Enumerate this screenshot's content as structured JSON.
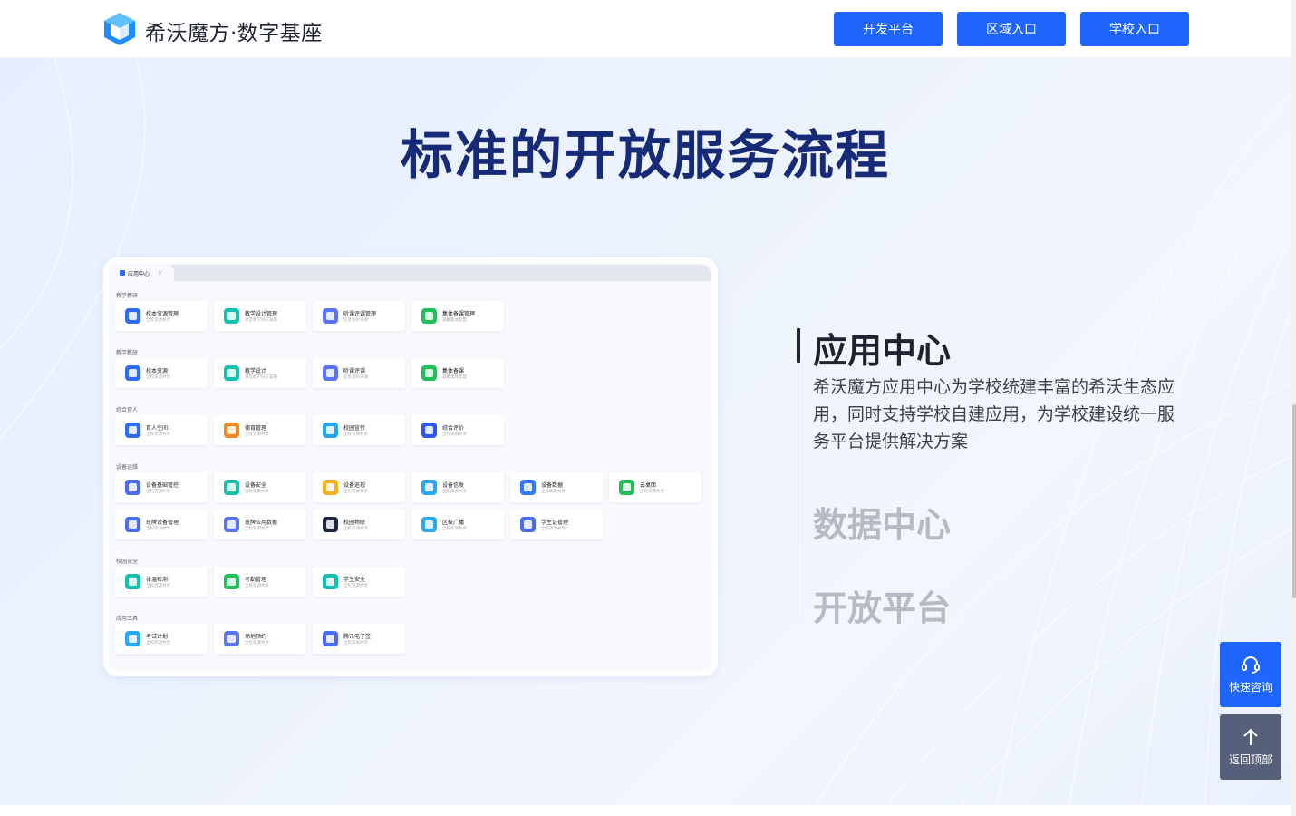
{
  "header": {
    "brand": "希沃魔方·数字基座",
    "buttons": [
      "开发平台",
      "区域入口",
      "学校入口"
    ]
  },
  "hero": {
    "title": "标准的开放服务流程"
  },
  "app_window": {
    "tab_label": "应用中心",
    "tab_close": "×",
    "sections": [
      {
        "title": "教学教研",
        "items": [
          {
            "name": "校本资源管理",
            "desc": "全校资源共享",
            "icon": "doc-icon",
            "color": "#2f6bff"
          },
          {
            "name": "教学设计管理",
            "desc": "课堂教学同在掌握",
            "icon": "design-icon",
            "color": "#14c0b0"
          },
          {
            "name": "听课评课管理",
            "desc": "信息化听评课",
            "icon": "listen-icon",
            "color": "#5b72f2"
          },
          {
            "name": "集体备课管理",
            "desc": "凝聚集体智慧",
            "icon": "group-icon",
            "color": "#22c05a"
          }
        ]
      },
      {
        "title": "教学教研",
        "items": [
          {
            "name": "校本资源",
            "desc": "全校资源共享",
            "icon": "doc-icon",
            "color": "#2f6bff"
          },
          {
            "name": "教学设计",
            "desc": "课堂教学同在掌握",
            "icon": "design-icon",
            "color": "#14c0b0"
          },
          {
            "name": "听课评课",
            "desc": "信息化听评课",
            "icon": "listen-icon",
            "color": "#5b72f2"
          },
          {
            "name": "集体备课",
            "desc": "凝聚集体智慧",
            "icon": "group-icon",
            "color": "#22c05a"
          }
        ]
      },
      {
        "title": "综合育人",
        "items": [
          {
            "name": "育人空间",
            "desc": "全校资源共享",
            "icon": "planet-icon",
            "color": "#2f6bff"
          },
          {
            "name": "德育管理",
            "desc": "全校资源共享",
            "icon": "trophy-icon",
            "color": "#f08a1c"
          },
          {
            "name": "校园宣传",
            "desc": "全校资源共享",
            "icon": "screen-icon",
            "color": "#26a6ef"
          },
          {
            "name": "综合评价",
            "desc": "全校资源共享",
            "icon": "eval-icon",
            "color": "#2f56f0"
          }
        ]
      },
      {
        "title": "设备运维",
        "items": [
          {
            "name": "设备基础管控",
            "desc": "全校资源共享",
            "icon": "device-icon",
            "color": "#4a6cf0"
          },
          {
            "name": "设备安全",
            "desc": "全校资源共享",
            "icon": "shield-icon",
            "color": "#16c2a8"
          },
          {
            "name": "设备巡视",
            "desc": "全校资源共享",
            "icon": "patrol-icon",
            "color": "#f5b21e"
          },
          {
            "name": "设备信发",
            "desc": "全校资源共享",
            "icon": "broadcast-icon",
            "color": "#2aa8f0"
          },
          {
            "name": "设备数据",
            "desc": "全校资源共享",
            "icon": "data-icon",
            "color": "#2f78ff"
          },
          {
            "name": "云桌面",
            "desc": "全校资源共享",
            "icon": "cloud-desktop-icon",
            "color": "#22c05a"
          },
          {
            "name": "班牌设备管理",
            "desc": "全校资源共享",
            "icon": "board-icon",
            "color": "#4a6cf0"
          },
          {
            "name": "班牌应用数据",
            "desc": "全校资源共享",
            "icon": "chart-icon",
            "color": "#5b72f2"
          },
          {
            "name": "校园物联",
            "desc": "全校资源共享",
            "icon": "iot-icon",
            "color": "#1d2740"
          },
          {
            "name": "区校广播",
            "desc": "全校资源共享",
            "icon": "radio-icon",
            "color": "#2aa8f0"
          },
          {
            "name": "学生证管理",
            "desc": "全校资源共享",
            "icon": "card-icon",
            "color": "#4a6cf0"
          }
        ]
      },
      {
        "title": "校园安全",
        "items": [
          {
            "name": "体温检测",
            "desc": "全校资源共享",
            "icon": "thermometer-icon",
            "color": "#14c0b0"
          },
          {
            "name": "考勤管理",
            "desc": "全校资源共享",
            "icon": "attendance-icon",
            "color": "#22c05a"
          },
          {
            "name": "学生安全",
            "desc": "全校资源共享",
            "icon": "student-icon",
            "color": "#14c0b0"
          }
        ]
      },
      {
        "title": "应用工具",
        "items": [
          {
            "name": "考试计划",
            "desc": "全校资源共享",
            "icon": "exam-icon",
            "color": "#2aa8f0"
          },
          {
            "name": "场地预约",
            "desc": "全校资源共享",
            "icon": "venue-icon",
            "color": "#5b72f2"
          },
          {
            "name": "腾讯电子签",
            "desc": "全校资源共享",
            "icon": "esign-icon",
            "color": "#4a6cf0"
          }
        ]
      }
    ]
  },
  "features": {
    "active_title": "应用中心",
    "active_desc": "希沃魔方应用中心为学校统建丰富的希沃生态应用，同时支持学校自建应用，为学校建设统一服务平台提供解决方案",
    "item2": "数据中心",
    "item3": "开放平台"
  },
  "floating": {
    "consult": "快速咨询",
    "top": "返回顶部"
  },
  "colors": {
    "primary": "#1f66ff",
    "title": "#162a78",
    "float_dark": "#56607a"
  }
}
